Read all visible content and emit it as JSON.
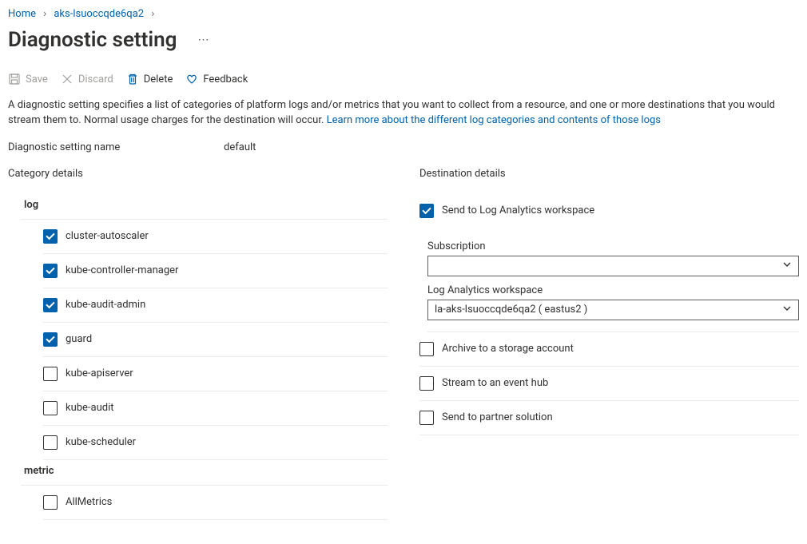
{
  "breadcrumb": {
    "home": "Home",
    "resource": "aks-lsuoccqde6qa2"
  },
  "page_title": "Diagnostic setting",
  "toolbar": {
    "save": "Save",
    "discard": "Discard",
    "delete": "Delete",
    "feedback": "Feedback"
  },
  "description_text": "A diagnostic setting specifies a list of categories of platform logs and/or metrics that you want to collect from a resource, and one or more destinations that you would stream them to. Normal usage charges for the destination will occur. ",
  "description_link": "Learn more about the different log categories and contents of those logs",
  "setting_name_label": "Diagnostic setting name",
  "setting_name_value": "default",
  "category_section_title": "Category details",
  "logs_group_label": "log",
  "metric_group_label": "metric",
  "logs": [
    {
      "label": "cluster-autoscaler",
      "checked": true
    },
    {
      "label": "kube-controller-manager",
      "checked": true
    },
    {
      "label": "kube-audit-admin",
      "checked": true
    },
    {
      "label": "guard",
      "checked": true
    },
    {
      "label": "kube-apiserver",
      "checked": false
    },
    {
      "label": "kube-audit",
      "checked": false
    },
    {
      "label": "kube-scheduler",
      "checked": false
    }
  ],
  "metrics": [
    {
      "label": "AllMetrics",
      "checked": false
    }
  ],
  "destination_section_title": "Destination details",
  "destinations": {
    "log_analytics": {
      "label": "Send to Log Analytics workspace",
      "checked": true,
      "subscription_label": "Subscription",
      "subscription_value": "",
      "workspace_label": "Log Analytics workspace",
      "workspace_value": "la-aks-lsuoccqde6qa2 ( eastus2 )"
    },
    "storage": {
      "label": "Archive to a storage account",
      "checked": false
    },
    "eventhub": {
      "label": "Stream to an event hub",
      "checked": false
    },
    "partner": {
      "label": "Send to partner solution",
      "checked": false
    }
  }
}
